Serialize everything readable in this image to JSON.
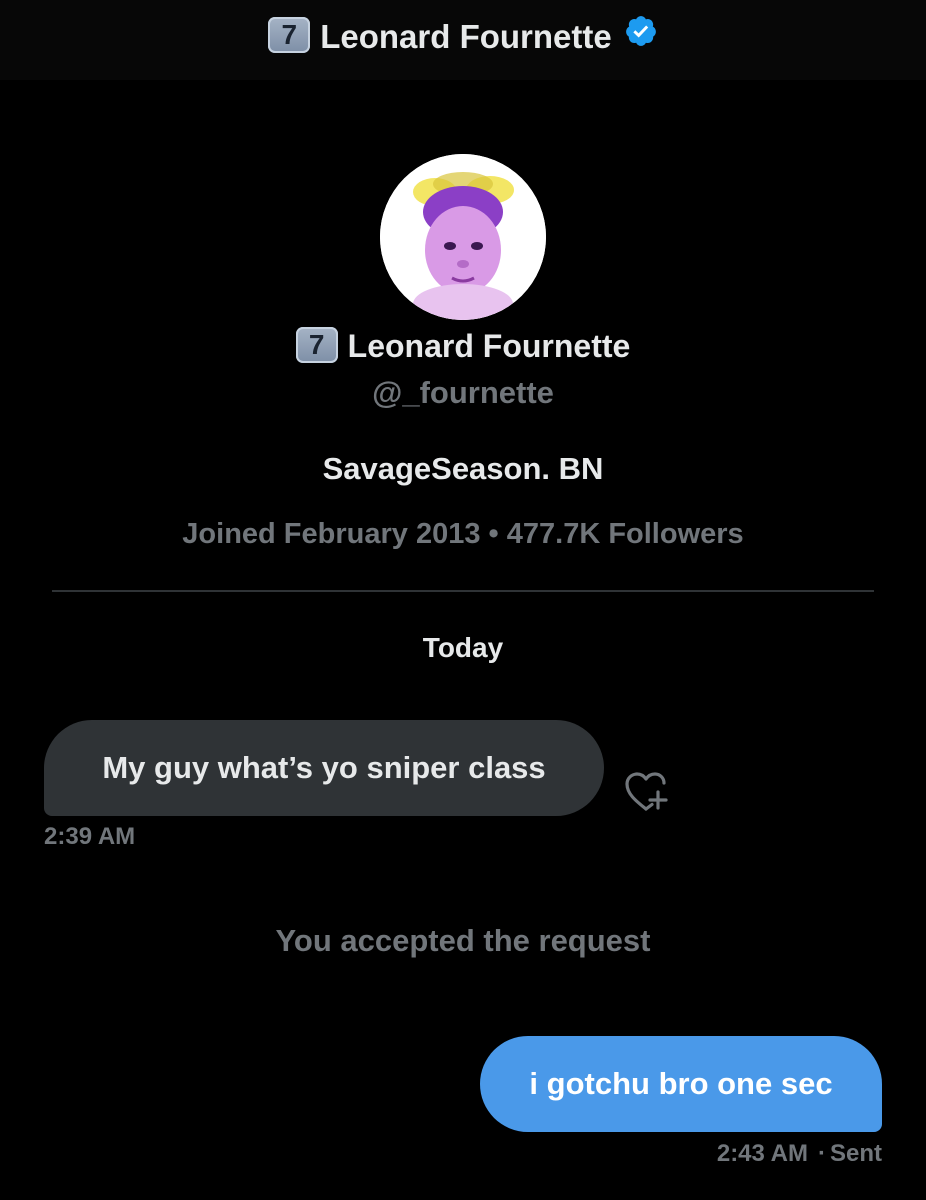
{
  "header": {
    "badge": "7",
    "name": "Leonard Fournette",
    "verified_icon": "verified-badge-icon"
  },
  "profile": {
    "avatar_icon": "profile-avatar",
    "badge": "7",
    "name": "Leonard Fournette",
    "handle": "@_fournette",
    "bio": "SavageSeason. BN",
    "meta": "Joined February 2013 • 477.7K Followers"
  },
  "conversation": {
    "date_separator": "Today",
    "messages": [
      {
        "direction": "incoming",
        "text": "My guy what’s yo sniper class",
        "time": "2:39 AM",
        "reaction_icon": "add-reaction-heart-icon"
      },
      {
        "direction": "outgoing",
        "text": "i gotchu bro one sec",
        "time": "2:43 AM",
        "status": "Sent"
      }
    ],
    "system_note": "You accepted the request"
  },
  "colors": {
    "background": "#000000",
    "bubble_incoming": "#2f3336",
    "bubble_outgoing": "#4a99e9",
    "muted_text": "#71767b",
    "verified": "#1d9bf0"
  }
}
